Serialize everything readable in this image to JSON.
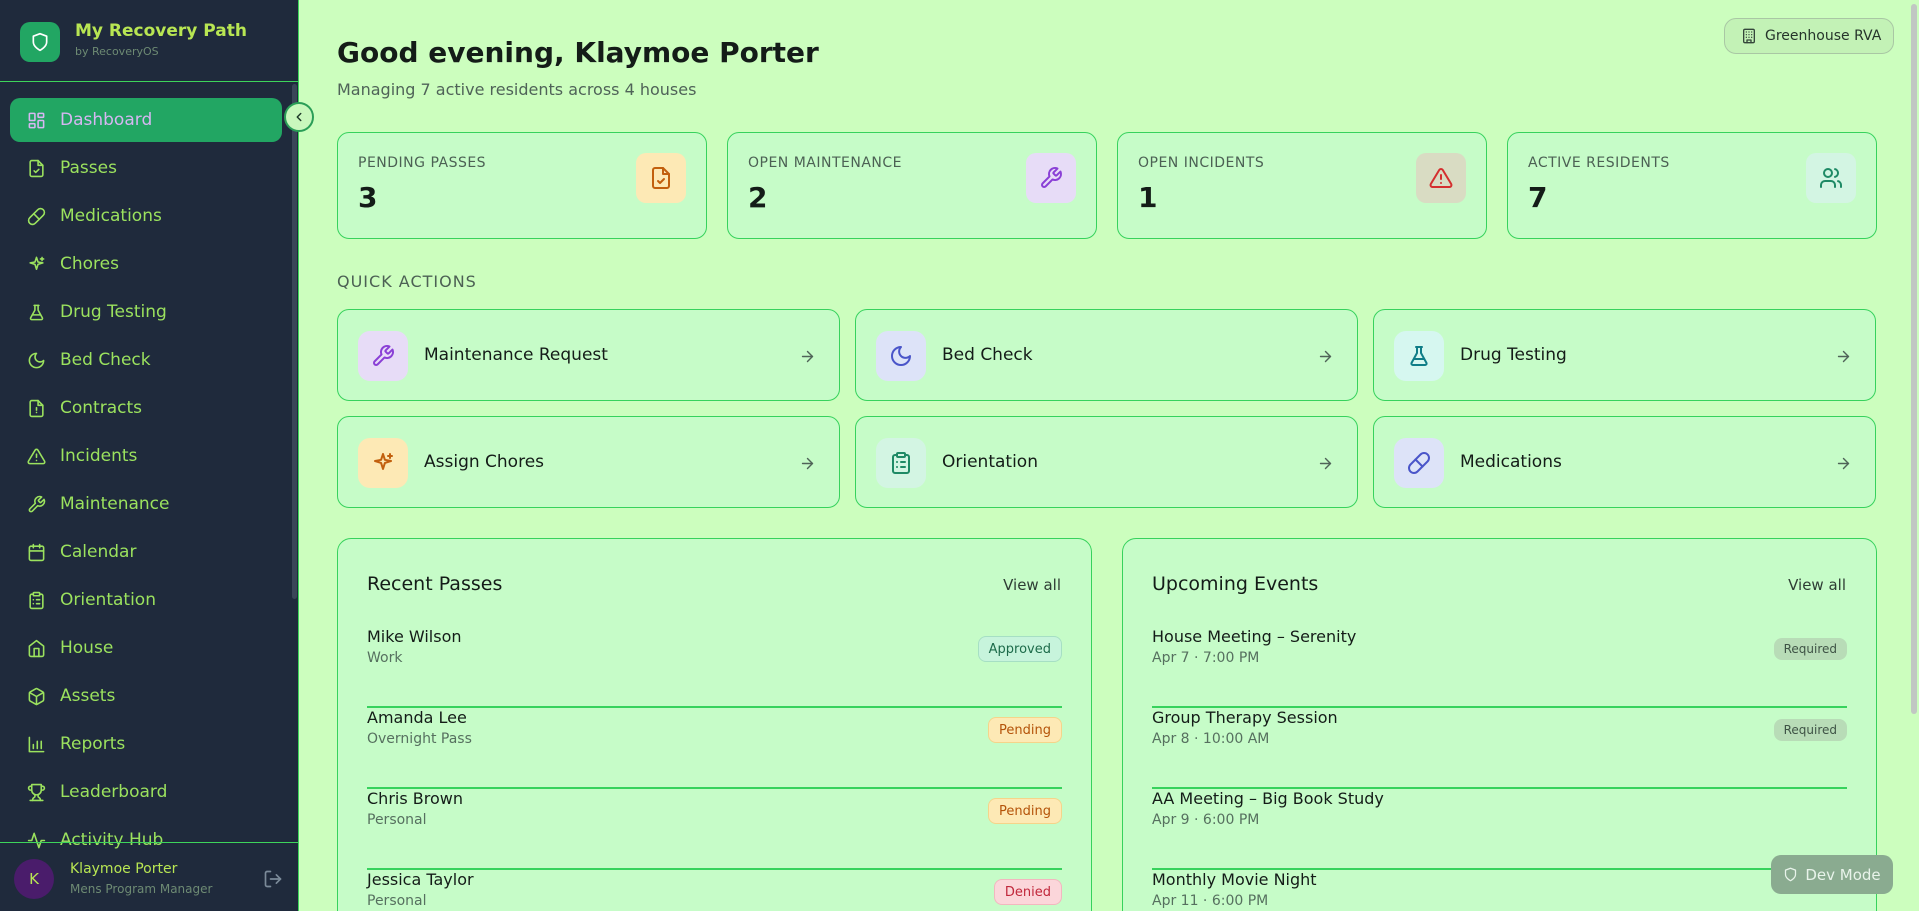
{
  "app": {
    "title": "My Recovery Path",
    "subtitle": "by RecoveryOS"
  },
  "sidebar": {
    "items": [
      {
        "label": "Dashboard",
        "icon": "dashboard-icon",
        "active": true
      },
      {
        "label": "Passes",
        "icon": "file-check-icon"
      },
      {
        "label": "Medications",
        "icon": "pill-icon"
      },
      {
        "label": "Chores",
        "icon": "sparkles-icon"
      },
      {
        "label": "Drug Testing",
        "icon": "flask-icon"
      },
      {
        "label": "Bed Check",
        "icon": "moon-icon"
      },
      {
        "label": "Contracts",
        "icon": "file-alert-icon"
      },
      {
        "label": "Incidents",
        "icon": "alert-triangle-icon"
      },
      {
        "label": "Maintenance",
        "icon": "wrench-icon"
      },
      {
        "label": "Calendar",
        "icon": "calendar-icon"
      },
      {
        "label": "Orientation",
        "icon": "clipboard-icon"
      },
      {
        "label": "House",
        "icon": "home-icon"
      },
      {
        "label": "Assets",
        "icon": "box-icon"
      },
      {
        "label": "Reports",
        "icon": "bar-chart-icon"
      },
      {
        "label": "Leaderboard",
        "icon": "trophy-icon"
      },
      {
        "label": "Activity Hub",
        "icon": "activity-icon"
      }
    ]
  },
  "user": {
    "initial": "K",
    "name": "Klaymoe Porter",
    "role": "Mens Program Manager"
  },
  "header": {
    "greeting": "Good evening, Klaymoe Porter",
    "subtitle": "Managing 7 active residents across 4 houses",
    "house": "Greenhouse RVA"
  },
  "stats": [
    {
      "label": "PENDING PASSES",
      "value": "3",
      "icon": "file-check-icon",
      "tint": "#fde9b5",
      "stroke": "#c2600e"
    },
    {
      "label": "OPEN MAINTENANCE",
      "value": "2",
      "icon": "wrench-icon",
      "tint": "#e7dcf7",
      "stroke": "#8a3fd6"
    },
    {
      "label": "OPEN INCIDENTS",
      "value": "1",
      "icon": "alert-triangle-icon",
      "tint": "#d9dcc3",
      "stroke": "#d42f2f"
    },
    {
      "label": "ACTIVE RESIDENTS",
      "value": "7",
      "icon": "users-icon",
      "tint": "#d3f5e3",
      "stroke": "#1e8a65"
    }
  ],
  "quick_actions": {
    "title": "QUICK ACTIONS",
    "items": [
      {
        "label": "Maintenance Request",
        "icon": "wrench-icon",
        "tint": "#e7dcf7",
        "stroke": "#8a3fd6"
      },
      {
        "label": "Bed Check",
        "icon": "moon-icon",
        "tint": "#dde3f8",
        "stroke": "#4a55c9"
      },
      {
        "label": "Drug Testing",
        "icon": "flask-icon",
        "tint": "#d6f7f0",
        "stroke": "#0f7d87"
      },
      {
        "label": "Assign Chores",
        "icon": "sparkles-icon",
        "tint": "#fde9b5",
        "stroke": "#c2600e"
      },
      {
        "label": "Orientation",
        "icon": "clipboard-icon",
        "tint": "#d3f5e3",
        "stroke": "#1e8a65"
      },
      {
        "label": "Medications",
        "icon": "pill-icon",
        "tint": "#dde3f8",
        "stroke": "#4a55c9"
      }
    ]
  },
  "recent_passes": {
    "title": "Recent Passes",
    "link": "View all",
    "rows": [
      {
        "name": "Mike Wilson",
        "sub": "Work",
        "status": "Approved",
        "bg": "#c7f4dc",
        "fg": "#1d6b4a",
        "border": "#a6dfc4"
      },
      {
        "name": "Amanda Lee",
        "sub": "Overnight Pass",
        "status": "Pending",
        "bg": "#fde9b5",
        "fg": "#b45309",
        "border": "#f5d48a"
      },
      {
        "name": "Chris Brown",
        "sub": "Personal",
        "status": "Pending",
        "bg": "#fde9b5",
        "fg": "#b45309",
        "border": "#f5d48a"
      },
      {
        "name": "Jessica Taylor",
        "sub": "Personal",
        "status": "Denied",
        "bg": "#fbd6da",
        "fg": "#c0273b",
        "border": "#f2b7bf"
      }
    ]
  },
  "upcoming_events": {
    "title": "Upcoming Events",
    "link": "View all",
    "rows": [
      {
        "name": "House Meeting – Serenity",
        "sub": "Apr 7 · 7:00 PM",
        "status": "Required"
      },
      {
        "name": "Group Therapy Session",
        "sub": "Apr 8 · 10:00 AM",
        "status": "Required"
      },
      {
        "name": "AA Meeting – Big Book Study",
        "sub": "Apr 9 · 6:00 PM",
        "status": ""
      },
      {
        "name": "Monthly Movie Night",
        "sub": "Apr 11 · 6:00 PM",
        "status": ""
      }
    ]
  },
  "dev_mode": {
    "label": "Dev Mode"
  }
}
